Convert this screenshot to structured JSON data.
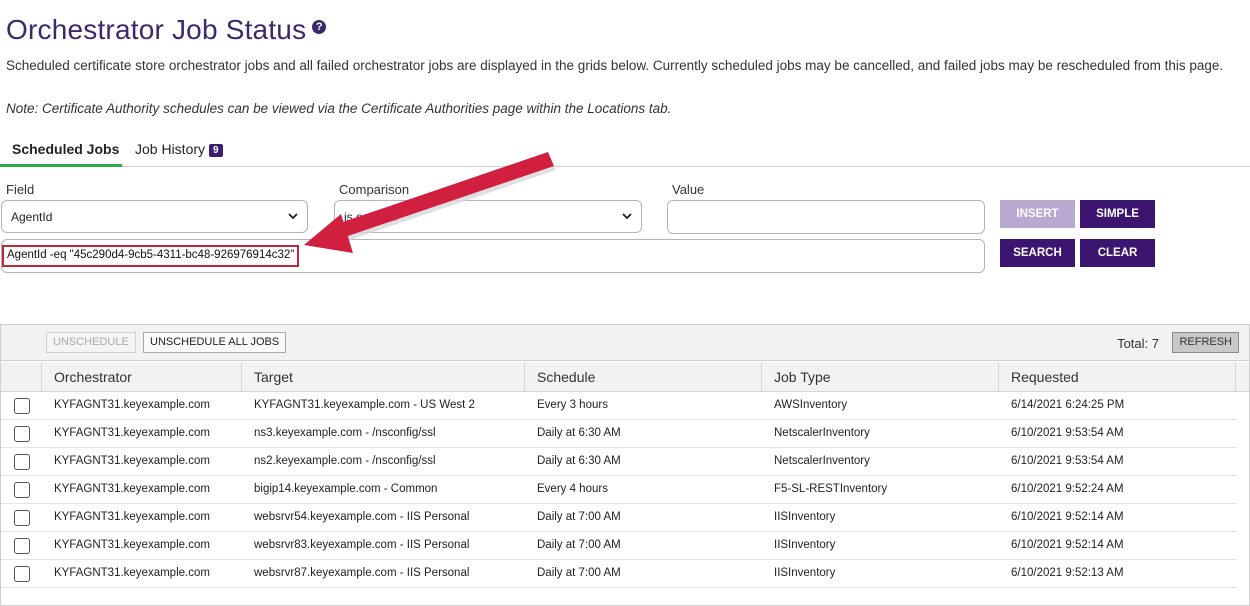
{
  "page": {
    "title": "Orchestrator Job Status",
    "description": "Scheduled certificate store orchestrator jobs and all failed orchestrator jobs are displayed in the grids below. Currently scheduled jobs may be cancelled, and failed jobs may be rescheduled from this page.",
    "note": "Note: Certificate Authority schedules can be viewed via the Certificate Authorities page within the Locations tab."
  },
  "tabs": [
    {
      "label": "Scheduled Jobs",
      "active": true
    },
    {
      "label": "Job History",
      "badge": "9",
      "active": false
    }
  ],
  "filter": {
    "field_label": "Field",
    "field_value": "AgentId",
    "comparison_label": "Comparison",
    "comparison_value": "is equal to",
    "value_label": "Value",
    "value_input": "",
    "query": "AgentId -eq \"45c290d4-9cb5-4311-bc48-926976914c32\"",
    "insert_label": "INSERT",
    "simple_label": "SIMPLE",
    "search_label": "SEARCH",
    "clear_label": "CLEAR"
  },
  "grid": {
    "unschedule_label": "UNSCHEDULE",
    "unschedule_all_label": "UNSCHEDULE ALL JOBS",
    "total_text": "Total: 7",
    "refresh_label": "REFRESH",
    "columns": [
      "Orchestrator",
      "Target",
      "Schedule",
      "Job Type",
      "Requested"
    ],
    "rows": [
      [
        "KYFAGNT31.keyexample.com",
        "KYFAGNT31.keyexample.com - US West 2",
        "Every 3 hours",
        "AWSInventory",
        "6/14/2021 6:24:25 PM"
      ],
      [
        "KYFAGNT31.keyexample.com",
        "ns3.keyexample.com - /nsconfig/ssl",
        "Daily at 6:30 AM",
        "NetscalerInventory",
        "6/10/2021 9:53:54 AM"
      ],
      [
        "KYFAGNT31.keyexample.com",
        "ns2.keyexample.com - /nsconfig/ssl",
        "Daily at 6:30 AM",
        "NetscalerInventory",
        "6/10/2021 9:53:54 AM"
      ],
      [
        "KYFAGNT31.keyexample.com",
        "bigip14.keyexample.com - Common",
        "Every 4 hours",
        "F5-SL-RESTInventory",
        "6/10/2021 9:52:24 AM"
      ],
      [
        "KYFAGNT31.keyexample.com",
        "websrvr54.keyexample.com - IIS Personal",
        "Daily at 7:00 AM",
        "IISInventory",
        "6/10/2021 9:52:14 AM"
      ],
      [
        "KYFAGNT31.keyexample.com",
        "websrvr83.keyexample.com - IIS Personal",
        "Daily at 7:00 AM",
        "IISInventory",
        "6/10/2021 9:52:14 AM"
      ],
      [
        "KYFAGNT31.keyexample.com",
        "websrvr87.keyexample.com - IIS Personal",
        "Daily at 7:00 AM",
        "IISInventory",
        "6/10/2021 9:52:13 AM"
      ]
    ]
  },
  "colors": {
    "brand_purple": "#3b1570",
    "tab_underline": "#2eac48",
    "highlight_red": "#c0263a"
  },
  "icons": {
    "help": "question-circle-icon",
    "select": "chevron-down-icon",
    "annotation": "red-arrow"
  }
}
